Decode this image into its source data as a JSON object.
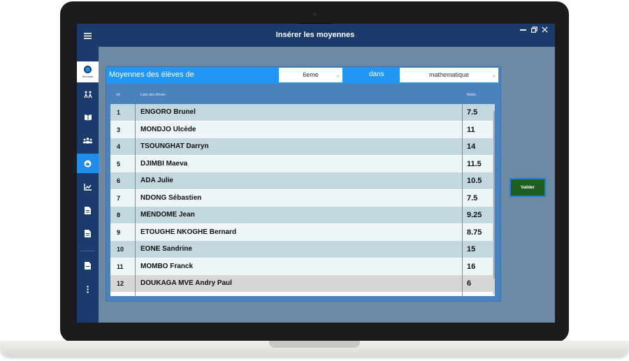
{
  "window": {
    "title": "Insérer les moyennes",
    "controls": [
      "minimize-icon",
      "restore-icon",
      "close-icon"
    ]
  },
  "sidebar": {
    "logo_text": "Scholars",
    "items": [
      {
        "icon": "menu-icon"
      },
      {
        "icon": "logo-icon"
      },
      {
        "icon": "family-icon"
      },
      {
        "icon": "book-icon"
      },
      {
        "icon": "group-icon"
      },
      {
        "icon": "home-icon",
        "active": true
      },
      {
        "icon": "chart-icon"
      },
      {
        "icon": "document-icon"
      },
      {
        "icon": "document-icon"
      },
      {
        "icon": "file-icon"
      },
      {
        "icon": "more-vertical-icon"
      }
    ]
  },
  "form": {
    "label": "Moyennes des élèves de",
    "class_select": "6eme",
    "dans_label": "dans",
    "subject_select": "mathematique"
  },
  "table": {
    "headers": [
      "Id",
      "Liste des élèves",
      "Notes"
    ],
    "rows": [
      {
        "id": "1",
        "name": "ENGORO Brunel",
        "note": "7.5"
      },
      {
        "id": "3",
        "name": "MONDJO Ulcède",
        "note": "11"
      },
      {
        "id": "4",
        "name": "TSOUNGHAT Darryn",
        "note": "14"
      },
      {
        "id": "5",
        "name": "DJIMBI Maeva",
        "note": "11.5"
      },
      {
        "id": "6",
        "name": "ADA Julie",
        "note": "10.5"
      },
      {
        "id": "7",
        "name": "NDONG Sébastien",
        "note": "7.5"
      },
      {
        "id": "8",
        "name": "MENDOME Jean",
        "note": "9.25"
      },
      {
        "id": "9",
        "name": "ETOUGHE NKOGHE Bernard",
        "note": "8.75"
      },
      {
        "id": "10",
        "name": "EONE Sandrine",
        "note": "15"
      },
      {
        "id": "11",
        "name": "MOMBO  Franck",
        "note": "16"
      },
      {
        "id": "12",
        "name": "DOUKAGA MVE Andry Paul",
        "note": "6"
      }
    ]
  },
  "actions": {
    "valider_label": "Valider"
  },
  "colors": {
    "sidebar": "#1b3b6c",
    "accent": "#2196f3",
    "row_even": "#c3d7df",
    "row_odd": "#eef5f8",
    "row_selected": "#d6d6d6",
    "valider_bg": "#1e5e20"
  }
}
